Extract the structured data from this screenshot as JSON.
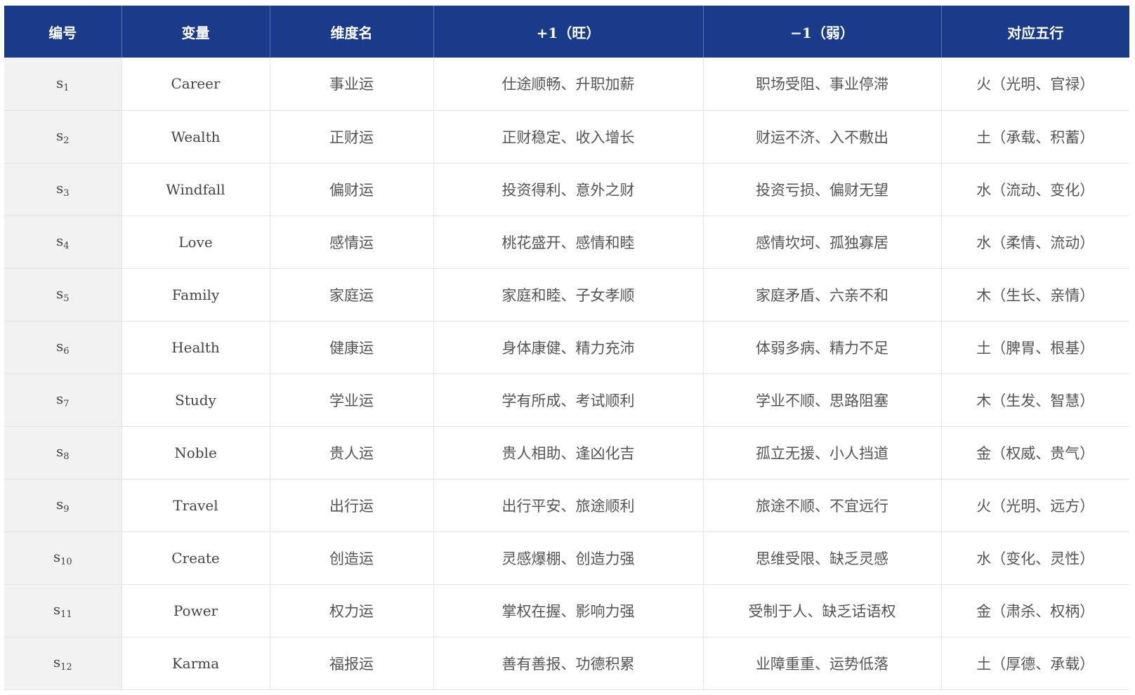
{
  "table": {
    "headers": [
      "编号",
      "变量",
      "维度名",
      "+1（旺）",
      "−1（弱）",
      "对应五行"
    ],
    "rows": [
      {
        "id": "s",
        "id_sub": "1",
        "var": "Career",
        "name": "事业运",
        "pos": "仕途顺畅、升职加薪",
        "neg": "职场受阻、事业停滞",
        "element": "火（光明、官禄）"
      },
      {
        "id": "s",
        "id_sub": "2",
        "var": "Wealth",
        "name": "正财运",
        "pos": "正财稳定、收入增长",
        "neg": "财运不济、入不敷出",
        "element": "土（承载、积蓄）"
      },
      {
        "id": "s",
        "id_sub": "3",
        "var": "Windfall",
        "name": "偏财运",
        "pos": "投资得利、意外之财",
        "neg": "投资亏损、偏财无望",
        "element": "水（流动、变化）"
      },
      {
        "id": "s",
        "id_sub": "4",
        "var": "Love",
        "name": "感情运",
        "pos": "桃花盛开、感情和睦",
        "neg": "感情坎坷、孤独寡居",
        "element": "水（柔情、流动）"
      },
      {
        "id": "s",
        "id_sub": "5",
        "var": "Family",
        "name": "家庭运",
        "pos": "家庭和睦、子女孝顺",
        "neg": "家庭矛盾、六亲不和",
        "element": "木（生长、亲情）"
      },
      {
        "id": "s",
        "id_sub": "6",
        "var": "Health",
        "name": "健康运",
        "pos": "身体康健、精力充沛",
        "neg": "体弱多病、精力不足",
        "element": "土（脾胃、根基）"
      },
      {
        "id": "s",
        "id_sub": "7",
        "var": "Study",
        "name": "学业运",
        "pos": "学有所成、考试顺利",
        "neg": "学业不顺、思路阻塞",
        "element": "木（生发、智慧）"
      },
      {
        "id": "s",
        "id_sub": "8",
        "var": "Noble",
        "name": "贵人运",
        "pos": "贵人相助、逢凶化吉",
        "neg": "孤立无援、小人挡道",
        "element": "金（权威、贵气）"
      },
      {
        "id": "s",
        "id_sub": "9",
        "var": "Travel",
        "name": "出行运",
        "pos": "出行平安、旅途顺利",
        "neg": "旅途不顺、不宜远行",
        "element": "火（光明、远方）"
      },
      {
        "id": "s",
        "id_sub": "10",
        "var": "Create",
        "name": "创造运",
        "pos": "灵感爆棚、创造力强",
        "neg": "思维受限、缺乏灵感",
        "element": "水（变化、灵性）"
      },
      {
        "id": "s",
        "id_sub": "11",
        "var": "Power",
        "name": "权力运",
        "pos": "掌权在握、影响力强",
        "neg": "受制于人、缺乏话语权",
        "element": "金（肃杀、权柄）"
      },
      {
        "id": "s",
        "id_sub": "12",
        "var": "Karma",
        "name": "福报运",
        "pos": "善有善报、功德积累",
        "neg": "业障重重、运势低落",
        "element": "土（厚德、承载）"
      }
    ]
  },
  "colors": {
    "header_bg": "#1a3a8a",
    "header_text": "#ffffff",
    "id_column_bg": "#f2f2f2",
    "body_text": "#555555"
  }
}
